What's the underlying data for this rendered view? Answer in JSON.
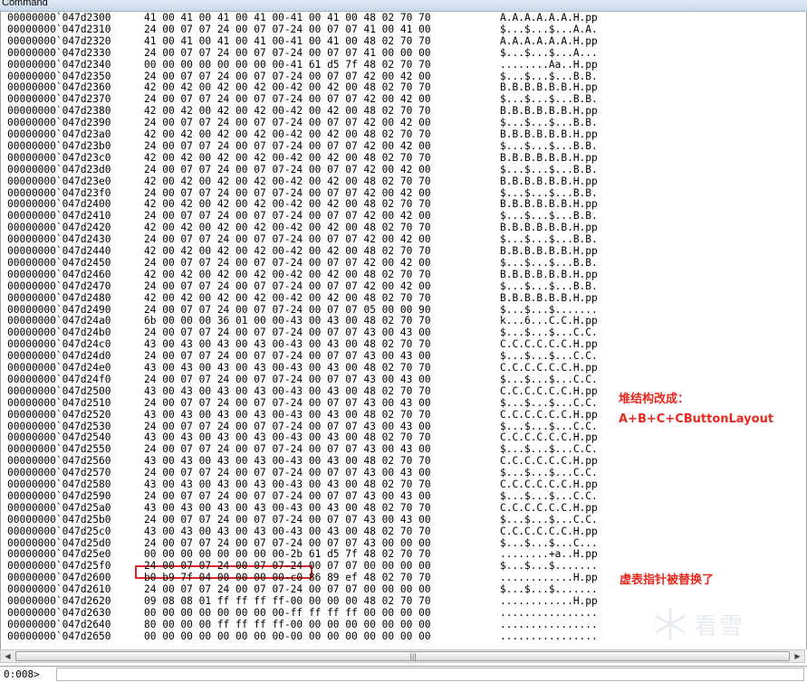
{
  "window": {
    "title": "Command"
  },
  "rows": [
    {
      "addr": "00000000`047d2300",
      "hex": "41 00 41 00 41 00 41 00-41 00 41 00 48 02 70 70",
      "ascii": "A.A.A.A.A.A.H.pp"
    },
    {
      "addr": "00000000`047d2310",
      "hex": "24 00 07 07 24 00 07 07-24 00 07 07 41 00 41 00",
      "ascii": "$...$...$...A.A."
    },
    {
      "addr": "00000000`047d2320",
      "hex": "41 00 41 00 41 00 41 00-41 00 41 00 48 02 70 70",
      "ascii": "A.A.A.A.A.A.H.pp"
    },
    {
      "addr": "00000000`047d2330",
      "hex": "24 00 07 07 24 00 07 07-24 00 07 07 41 00 00 00",
      "ascii": "$...$...$...A..."
    },
    {
      "addr": "00000000`047d2340",
      "hex": "00 00 00 00 00 00 00 00-41 61 d5 7f 48 02 70 70",
      "ascii": "........Aa..H.pp"
    },
    {
      "addr": "00000000`047d2350",
      "hex": "24 00 07 07 24 00 07 07-24 00 07 07 42 00 42 00",
      "ascii": "$...$...$...B.B."
    },
    {
      "addr": "00000000`047d2360",
      "hex": "42 00 42 00 42 00 42 00-42 00 42 00 48 02 70 70",
      "ascii": "B.B.B.B.B.B.H.pp"
    },
    {
      "addr": "00000000`047d2370",
      "hex": "24 00 07 07 24 00 07 07-24 00 07 07 42 00 42 00",
      "ascii": "$...$...$...B.B."
    },
    {
      "addr": "00000000`047d2380",
      "hex": "42 00 42 00 42 00 42 00-42 00 42 00 48 02 70 70",
      "ascii": "B.B.B.B.B.B.H.pp"
    },
    {
      "addr": "00000000`047d2390",
      "hex": "24 00 07 07 24 00 07 07-24 00 07 07 42 00 42 00",
      "ascii": "$...$...$...B.B."
    },
    {
      "addr": "00000000`047d23a0",
      "hex": "42 00 42 00 42 00 42 00-42 00 42 00 48 02 70 70",
      "ascii": "B.B.B.B.B.B.H.pp"
    },
    {
      "addr": "00000000`047d23b0",
      "hex": "24 00 07 07 24 00 07 07-24 00 07 07 42 00 42 00",
      "ascii": "$...$...$...B.B."
    },
    {
      "addr": "00000000`047d23c0",
      "hex": "42 00 42 00 42 00 42 00-42 00 42 00 48 02 70 70",
      "ascii": "B.B.B.B.B.B.H.pp"
    },
    {
      "addr": "00000000`047d23d0",
      "hex": "24 00 07 07 24 00 07 07-24 00 07 07 42 00 42 00",
      "ascii": "$...$...$...B.B."
    },
    {
      "addr": "00000000`047d23e0",
      "hex": "42 00 42 00 42 00 42 00-42 00 42 00 48 02 70 70",
      "ascii": "B.B.B.B.B.B.H.pp"
    },
    {
      "addr": "00000000`047d23f0",
      "hex": "24 00 07 07 24 00 07 07-24 00 07 07 42 00 42 00",
      "ascii": "$...$...$...B.B."
    },
    {
      "addr": "00000000`047d2400",
      "hex": "42 00 42 00 42 00 42 00-42 00 42 00 48 02 70 70",
      "ascii": "B.B.B.B.B.B.H.pp"
    },
    {
      "addr": "00000000`047d2410",
      "hex": "24 00 07 07 24 00 07 07-24 00 07 07 42 00 42 00",
      "ascii": "$...$...$...B.B."
    },
    {
      "addr": "00000000`047d2420",
      "hex": "42 00 42 00 42 00 42 00-42 00 42 00 48 02 70 70",
      "ascii": "B.B.B.B.B.B.H.pp"
    },
    {
      "addr": "00000000`047d2430",
      "hex": "24 00 07 07 24 00 07 07-24 00 07 07 42 00 42 00",
      "ascii": "$...$...$...B.B."
    },
    {
      "addr": "00000000`047d2440",
      "hex": "42 00 42 00 42 00 42 00-42 00 42 00 48 02 70 70",
      "ascii": "B.B.B.B.B.B.H.pp"
    },
    {
      "addr": "00000000`047d2450",
      "hex": "24 00 07 07 24 00 07 07-24 00 07 07 42 00 42 00",
      "ascii": "$...$...$...B.B."
    },
    {
      "addr": "00000000`047d2460",
      "hex": "42 00 42 00 42 00 42 00-42 00 42 00 48 02 70 70",
      "ascii": "B.B.B.B.B.B.H.pp"
    },
    {
      "addr": "00000000`047d2470",
      "hex": "24 00 07 07 24 00 07 07-24 00 07 07 42 00 42 00",
      "ascii": "$...$...$...B.B."
    },
    {
      "addr": "00000000`047d2480",
      "hex": "42 00 42 00 42 00 42 00-42 00 42 00 48 02 70 70",
      "ascii": "B.B.B.B.B.B.H.pp"
    },
    {
      "addr": "00000000`047d2490",
      "hex": "24 00 07 07 24 00 07 07-24 00 07 07 05 00 00 90",
      "ascii": "$...$...$......."
    },
    {
      "addr": "00000000`047d24a0",
      "hex": "6b 00 00 00 36 01 00 00-43 00 43 00 48 02 70 70",
      "ascii": "k...6...C.C.H.pp"
    },
    {
      "addr": "00000000`047d24b0",
      "hex": "24 00 07 07 24 00 07 07-24 00 07 07 43 00 43 00",
      "ascii": "$...$...$...C.C."
    },
    {
      "addr": "00000000`047d24c0",
      "hex": "43 00 43 00 43 00 43 00-43 00 43 00 48 02 70 70",
      "ascii": "C.C.C.C.C.C.H.pp"
    },
    {
      "addr": "00000000`047d24d0",
      "hex": "24 00 07 07 24 00 07 07-24 00 07 07 43 00 43 00",
      "ascii": "$...$...$...C.C."
    },
    {
      "addr": "00000000`047d24e0",
      "hex": "43 00 43 00 43 00 43 00-43 00 43 00 48 02 70 70",
      "ascii": "C.C.C.C.C.C.H.pp"
    },
    {
      "addr": "00000000`047d24f0",
      "hex": "24 00 07 07 24 00 07 07-24 00 07 07 43 00 43 00",
      "ascii": "$...$...$...C.C."
    },
    {
      "addr": "00000000`047d2500",
      "hex": "43 00 43 00 43 00 43 00-43 00 43 00 48 02 70 70",
      "ascii": "C.C.C.C.C.C.H.pp"
    },
    {
      "addr": "00000000`047d2510",
      "hex": "24 00 07 07 24 00 07 07-24 00 07 07 43 00 43 00",
      "ascii": "$...$...$...C.C."
    },
    {
      "addr": "00000000`047d2520",
      "hex": "43 00 43 00 43 00 43 00-43 00 43 00 48 02 70 70",
      "ascii": "C.C.C.C.C.C.H.pp"
    },
    {
      "addr": "00000000`047d2530",
      "hex": "24 00 07 07 24 00 07 07-24 00 07 07 43 00 43 00",
      "ascii": "$...$...$...C.C."
    },
    {
      "addr": "00000000`047d2540",
      "hex": "43 00 43 00 43 00 43 00-43 00 43 00 48 02 70 70",
      "ascii": "C.C.C.C.C.C.H.pp"
    },
    {
      "addr": "00000000`047d2550",
      "hex": "24 00 07 07 24 00 07 07-24 00 07 07 43 00 43 00",
      "ascii": "$...$...$...C.C."
    },
    {
      "addr": "00000000`047d2560",
      "hex": "43 00 43 00 43 00 43 00-43 00 43 00 48 02 70 70",
      "ascii": "C.C.C.C.C.C.H.pp"
    },
    {
      "addr": "00000000`047d2570",
      "hex": "24 00 07 07 24 00 07 07-24 00 07 07 43 00 43 00",
      "ascii": "$...$...$...C.C."
    },
    {
      "addr": "00000000`047d2580",
      "hex": "43 00 43 00 43 00 43 00-43 00 43 00 48 02 70 70",
      "ascii": "C.C.C.C.C.C.H.pp"
    },
    {
      "addr": "00000000`047d2590",
      "hex": "24 00 07 07 24 00 07 07-24 00 07 07 43 00 43 00",
      "ascii": "$...$...$...C.C."
    },
    {
      "addr": "00000000`047d25a0",
      "hex": "43 00 43 00 43 00 43 00-43 00 43 00 48 02 70 70",
      "ascii": "C.C.C.C.C.C.H.pp"
    },
    {
      "addr": "00000000`047d25b0",
      "hex": "24 00 07 07 24 00 07 07-24 00 07 07 43 00 43 00",
      "ascii": "$...$...$...C.C."
    },
    {
      "addr": "00000000`047d25c0",
      "hex": "43 00 43 00 43 00 43 00-43 00 43 00 48 02 70 70",
      "ascii": "C.C.C.C.C.C.H.pp"
    },
    {
      "addr": "00000000`047d25d0",
      "hex": "24 00 07 07 24 00 07 07-24 00 07 07 43 00 00 00",
      "ascii": "$...$...$...C..."
    },
    {
      "addr": "00000000`047d25e0",
      "hex": "00 00 00 00 00 00 00 00-2b 61 d5 7f 48 02 70 70",
      "ascii": "........+a..H.pp"
    },
    {
      "addr": "00000000`047d25f0",
      "hex": "24 00 07 07 24 00 07 07-24 00 07 07 00 00 00 00",
      "ascii": "$...$...$......."
    },
    {
      "addr": "00000000`047d2600",
      "hex": "b0 b9 7f 04 00 00 00 00-c0 86 89 ef 48 02 70 70",
      "ascii": "............H.pp"
    },
    {
      "addr": "00000000`047d2610",
      "hex": "24 00 07 07 24 00 07 07-24 00 07 07 00 00 00 00",
      "ascii": "$...$...$......."
    },
    {
      "addr": "00000000`047d2620",
      "hex": "09 08 08 01 ff ff ff ff-00 00 00 00 48 02 70 70",
      "ascii": "............H.pp"
    },
    {
      "addr": "00000000`047d2630",
      "hex": "00 00 00 00 00 00 00 00-ff ff ff ff 00 00 00 00",
      "ascii": "................"
    },
    {
      "addr": "00000000`047d2640",
      "hex": "80 00 00 00 ff ff ff ff-00 00 00 00 00 00 00 00",
      "ascii": "................"
    },
    {
      "addr": "00000000`047d2650",
      "hex": "00 00 00 00 00 00 00 00-00 00 00 00 00 00 00 00",
      "ascii": "................"
    }
  ],
  "annotations": {
    "heap_title": "堆结构改成：",
    "heap_formula": "A+B+C+CButtonLayout",
    "vtable_note": "虚表指针被替换了"
  },
  "command": {
    "prompt": "0:008>",
    "value": ""
  },
  "watermark": {
    "text": "看雪"
  },
  "colors": {
    "annotation": "#e8281e",
    "highlight_box": "#e0262b"
  }
}
